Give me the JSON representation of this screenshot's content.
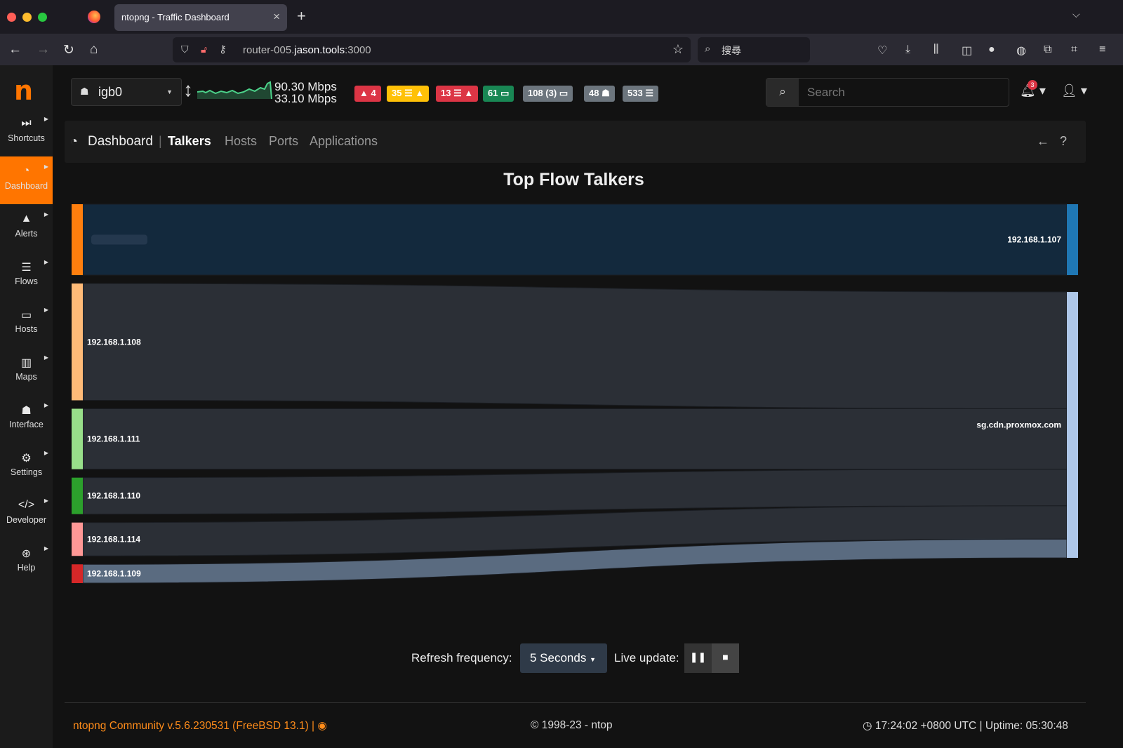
{
  "browser": {
    "tab_title": "ntopng - Traffic Dashboard",
    "url_host_prefix": "router-005.",
    "url_host_main": "jason.tools",
    "url_port": ":3000",
    "search_placeholder": "搜尋"
  },
  "sidebar": {
    "logo": "n",
    "items": [
      {
        "label": "Shortcuts",
        "icon": "forward-icon"
      },
      {
        "label": "Dashboard",
        "icon": "gauge-icon"
      },
      {
        "label": "Alerts",
        "icon": "warning-icon"
      },
      {
        "label": "Flows",
        "icon": "list-icon"
      },
      {
        "label": "Hosts",
        "icon": "laptop-icon"
      },
      {
        "label": "Maps",
        "icon": "map-icon"
      },
      {
        "label": "Interface",
        "icon": "ethernet-icon"
      },
      {
        "label": "Settings",
        "icon": "gear-icon"
      },
      {
        "label": "Developer",
        "icon": "code-icon"
      },
      {
        "label": "Help",
        "icon": "lifebuoy-icon"
      }
    ]
  },
  "topbar": {
    "interface": "igb0",
    "rate_up": "90.30 Mbps",
    "rate_down": "33.10 Mbps",
    "badges": [
      {
        "text": "4",
        "icon": "▲",
        "icon_first": true,
        "color": "#dc3545"
      },
      {
        "text": "35",
        "icon": "☰ ▲",
        "icon_first": false,
        "color": "#ffc107"
      },
      {
        "text": "13",
        "icon": "☰ ▲",
        "icon_first": false,
        "color": "#dc3545"
      },
      {
        "text": "61",
        "icon": "▭",
        "icon_first": false,
        "color": "#198754"
      },
      {
        "text": "108 (3)",
        "icon": "▭",
        "icon_first": false,
        "color": "#6c757d"
      },
      {
        "text": "48",
        "icon": "☗",
        "icon_first": false,
        "color": "#6c757d"
      },
      {
        "text": "533",
        "icon": "☰",
        "icon_first": false,
        "color": "#6c757d"
      }
    ],
    "search_placeholder": "Search",
    "notification_count": "3"
  },
  "breadcrumb": {
    "root": "Dashboard",
    "tabs": [
      "Talkers",
      "Hosts",
      "Ports",
      "Applications"
    ],
    "active": "Talkers"
  },
  "chart_title": "Top Flow Talkers",
  "chart_data": {
    "type": "sankey",
    "sources": [
      {
        "name": "",
        "value": 34,
        "color": "#ff7f0e",
        "target": "192.168.1.107"
      },
      {
        "name": "192.168.1.108",
        "value": 56,
        "color": "#ffbb78",
        "target": "sg.cdn.proxmox.com"
      },
      {
        "name": "192.168.1.111",
        "value": 29,
        "color": "#98df8a",
        "target": "sg.cdn.proxmox.com"
      },
      {
        "name": "192.168.1.110",
        "value": 17.5,
        "color": "#2ca02c",
        "target": "sg.cdn.proxmox.com"
      },
      {
        "name": "192.168.1.114",
        "value": 16,
        "color": "#ff9896",
        "target": "sg.cdn.proxmox.com"
      },
      {
        "name": "192.168.1.109",
        "value": 9,
        "color": "#d62728",
        "target": "sg.cdn.proxmox.com"
      }
    ],
    "targets": [
      {
        "name": "192.168.1.107",
        "color": "#1f77b4"
      },
      {
        "name": "sg.cdn.proxmox.com",
        "color": "#aec7e8"
      }
    ]
  },
  "refresh": {
    "label": "Refresh frequency:",
    "value": "5 Seconds",
    "live_label": "Live update:"
  },
  "footer": {
    "version": "ntopng Community v.5.6.230531 (FreeBSD 13.1) |",
    "copyright": "© 1998-23 - ntop",
    "time": "17:24:02 +0800 UTC | Uptime: 05:30:48"
  }
}
